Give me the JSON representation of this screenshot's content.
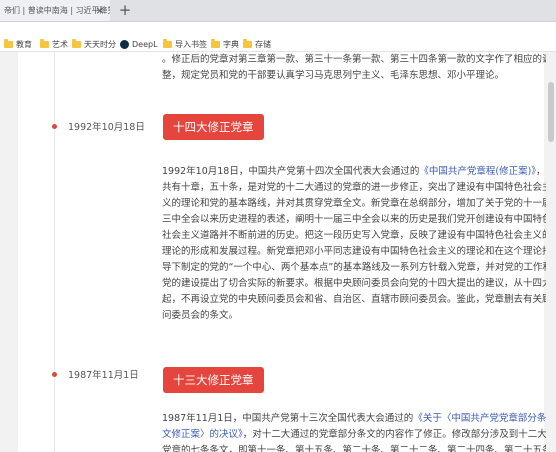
{
  "browser": {
    "tab_title": "帝们 | 曾读中南海 | 习近平降笑",
    "tab_close": "×",
    "new_tab": "+",
    "bookmarks": [
      {
        "label": "教育",
        "icon": "folder-icon"
      },
      {
        "label": "艺术",
        "icon": "folder-icon"
      },
      {
        "label": "天天时分",
        "icon": "folder-icon"
      },
      {
        "label": "DeepL",
        "icon": "deepl-icon"
      },
      {
        "label": "导入书签",
        "icon": "folder-icon"
      },
      {
        "label": "字典",
        "icon": "folder-icon"
      },
      {
        "label": "存储",
        "icon": "folder-icon"
      }
    ]
  },
  "timeline": {
    "top_text": "。修正后的党章对第三章第一款、第三十一条第一款、第三十四条第一款的文字作了相应的调整，规定党员和党的干部要认真学习马克思列宁主义、毛泽东思想、邓小平理论。",
    "entries": [
      {
        "date": "1992年10月18日",
        "title": "十四大修正党章",
        "para_before": "1992年10月18日，中国共产党第十四次全国代表大会通过的",
        "para_link": "《中国共产党章程(修正案)》",
        "para_after": "，共有十章，五十条，是对党的十二大通过的党章的进一步修正，突出了建设有中国特色社会主义的理论和党的基本路线，并对其贯穿党章全文。新党章在总纲部分，增加了关于党的十一届三中全会以来历史进程的表述，阐明十一届三中全会以来的历史是我们党开创建设有中国特色社会主义道路并不断前进的历史。把这一段历史写入党章，反映了建设有中国特色社会主义的理论的形成和发展过程。新党章把邓小平同志建设有中国特色社会主义的理论和在这个理论指导下制定的党的“一个中心、两个基本点”的基本路线及一系列方针载入党章，并对党的工作和党的建设提出了切合实际的新要求。根据中央顾问委员会向党的十四大提出的建议，从十四大起，不再设立党的中央顾问委员会和省、自治区、直辖市顾问委员会。鉴此，党章删去有关顾问委员会的条文。"
      },
      {
        "date": "1987年11月1日",
        "title": "十三大修正党章",
        "para_before": "1987年11月1日，中国共产党第十三次全国代表大会通过的",
        "para_link": "《关于〈中国共产党党章部分条文修正案〉的决议》",
        "para_after": "，对十二大通过的党章部分条文的内容作了修正。修改部分涉及到十二大党章的七条条文，即第十一条、第十五条、第二十条、第二十二条、第二十四条、第二十五条"
      }
    ]
  },
  "colors": {
    "accent": "#e5453d",
    "link": "#3d5bb8",
    "text": "#444444"
  }
}
